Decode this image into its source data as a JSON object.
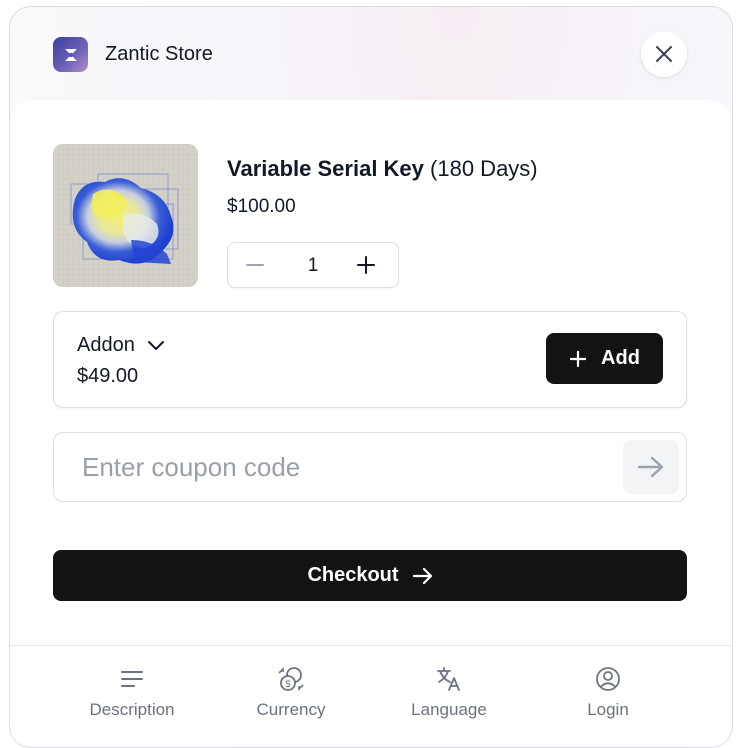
{
  "header": {
    "store_name": "Zantic Store",
    "logo_icon": "zantic-logo",
    "close_icon": "close-icon"
  },
  "product": {
    "title": "Variable Serial Key",
    "duration": "(180 Days)",
    "price": "$100.00",
    "quantity": "1"
  },
  "addon": {
    "name": "Addon",
    "price": "$49.00",
    "add_label": "Add"
  },
  "coupon": {
    "placeholder": "Enter coupon code",
    "value": ""
  },
  "checkout": {
    "label": "Checkout"
  },
  "nav": {
    "items": [
      {
        "label": "Description",
        "icon": "menu-lines-icon"
      },
      {
        "label": "Currency",
        "icon": "currency-exchange-icon"
      },
      {
        "label": "Language",
        "icon": "translate-icon"
      },
      {
        "label": "Login",
        "icon": "user-circle-icon"
      }
    ]
  },
  "colors": {
    "primary_button": "#131316",
    "muted_text": "#6b7280",
    "border": "#dcdfe4"
  }
}
